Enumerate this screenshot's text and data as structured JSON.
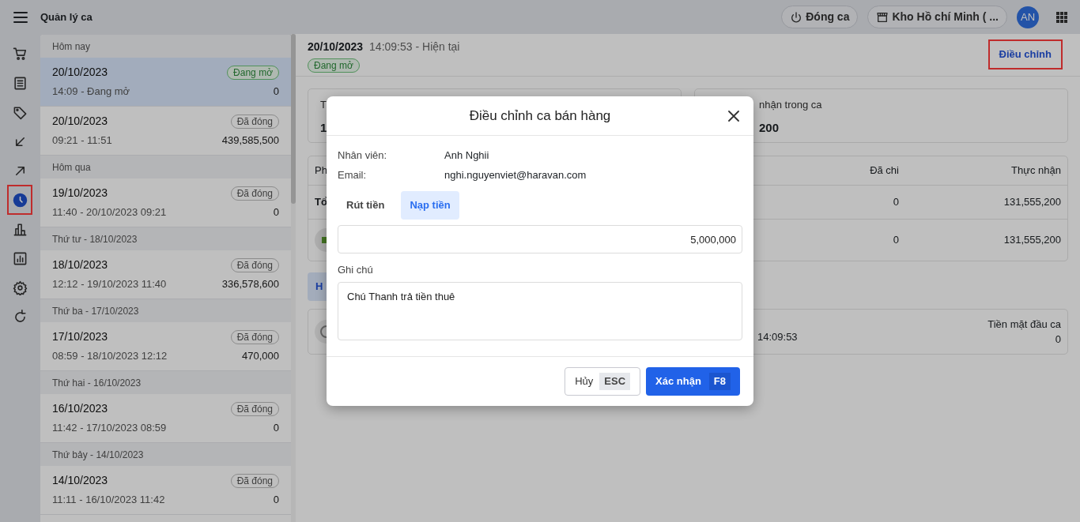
{
  "app": {
    "title": "Quản lý ca"
  },
  "header_actions": {
    "close_shift": "Đóng ca",
    "store": "Kho Hồ chí Minh ( ...",
    "avatar": "AN"
  },
  "rail": [
    {
      "selected": false,
      "annotated": false
    },
    {
      "selected": false,
      "annotated": false
    },
    {
      "selected": false,
      "annotated": false
    },
    {
      "selected": false,
      "annotated": false
    },
    {
      "selected": false,
      "annotated": false
    },
    {
      "selected": true,
      "annotated": true
    },
    {
      "selected": false,
      "annotated": false
    },
    {
      "selected": false,
      "annotated": false
    },
    {
      "selected": false,
      "annotated": false
    },
    {
      "selected": false,
      "annotated": false
    }
  ],
  "shift_groups": [
    {
      "heading": "Hôm nay",
      "shifts": [
        {
          "date": "20/10/2023",
          "time": "14:09 - Đang mở",
          "amount": "0",
          "status": "Đang mở",
          "kind": "open",
          "selected": true
        },
        {
          "date": "20/10/2023",
          "time": "09:21 - 11:51",
          "amount": "439,585,500",
          "status": "Đã đóng",
          "kind": "closed",
          "selected": false
        }
      ]
    },
    {
      "heading": "Hôm qua",
      "shifts": [
        {
          "date": "19/10/2023",
          "time": "11:40 - 20/10/2023 09:21",
          "amount": "0",
          "status": "Đã đóng",
          "kind": "closed",
          "selected": false
        }
      ]
    },
    {
      "heading": "Thứ tư - 18/10/2023",
      "shifts": [
        {
          "date": "18/10/2023",
          "time": "12:12 - 19/10/2023 11:40",
          "amount": "336,578,600",
          "status": "Đã đóng",
          "kind": "closed",
          "selected": false
        }
      ]
    },
    {
      "heading": "Thứ ba - 17/10/2023",
      "shifts": [
        {
          "date": "17/10/2023",
          "time": "08:59 - 18/10/2023 12:12",
          "amount": "470,000",
          "status": "Đã đóng",
          "kind": "closed",
          "selected": false
        }
      ]
    },
    {
      "heading": "Thứ hai - 16/10/2023",
      "shifts": [
        {
          "date": "16/10/2023",
          "time": "11:42 - 17/10/2023 08:59",
          "amount": "0",
          "status": "Đã đóng",
          "kind": "closed",
          "selected": false
        }
      ]
    },
    {
      "heading": "Thứ bảy - 14/10/2023",
      "shifts": [
        {
          "date": "14/10/2023",
          "time": "11:11 - 16/10/2023 11:42",
          "amount": "0",
          "status": "Đã đóng",
          "kind": "closed",
          "selected": false
        }
      ]
    }
  ],
  "detail": {
    "date": "20/10/2023",
    "time": "14:09:53 - Hiện tại",
    "status": "Đang mở",
    "kind": "open",
    "adjust_button": {
      "label": "Điều chỉnh",
      "annotated": true
    }
  },
  "summary_cards": [
    {
      "label": "T",
      "value": "1"
    },
    {
      "label": "nhận trong ca",
      "value": "200"
    }
  ],
  "payments_table": {
    "columns": [
      "Ph",
      "Đã chi",
      "Thực nhận"
    ],
    "rows": [
      {
        "kind": "total",
        "label": "Tổ",
        "spent": "0",
        "received": "131,555,200"
      },
      {
        "kind": "method",
        "spent": "0",
        "received": "131,555,200"
      }
    ]
  },
  "history_tab": "H",
  "opening_card": {
    "time": "14:09:53",
    "label": "Tiền mặt đầu ca",
    "value": "0"
  },
  "modal": {
    "title": "Điều chỉnh ca bán hàng",
    "fields": [
      {
        "label": "Nhân viên:",
        "value": "Anh Nghii"
      },
      {
        "label": "Email:",
        "value": "nghi.nguyenviet@haravan.com"
      }
    ],
    "tabs": [
      {
        "label": "Rút tiền",
        "selected": false
      },
      {
        "label": "Nạp tiền",
        "selected": true
      }
    ],
    "amount": "5,000,000",
    "note_label": "Ghi chú",
    "note": "Chú Thanh trả tiền thuê",
    "cancel": {
      "label": "Hủy",
      "key": "ESC"
    },
    "confirm": {
      "label": "Xác nhận",
      "key": "F8"
    }
  }
}
